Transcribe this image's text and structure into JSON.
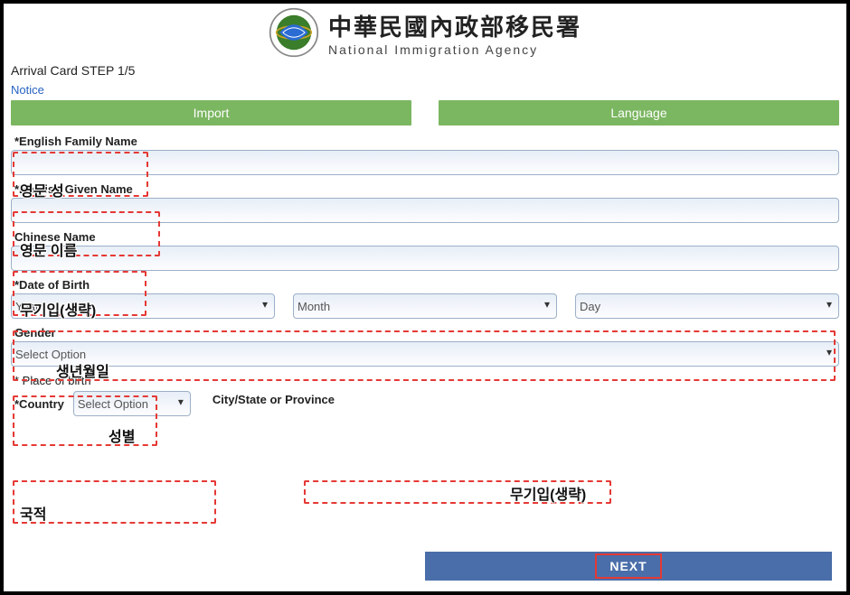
{
  "header": {
    "title_cn": "中華民國內政部移民署",
    "title_en": "National Immigration Agency"
  },
  "step": "Arrival Card STEP 1/5",
  "notice": "Notice",
  "top_buttons": {
    "import": "Import",
    "language": "Language"
  },
  "fields": {
    "family_name": {
      "label": "*English Family Name",
      "value": ""
    },
    "given_name": {
      "label": "*English Given Name",
      "value": ""
    },
    "chinese_name": {
      "label": "Chinese Name",
      "value": ""
    },
    "dob": {
      "label": "*Date of Birth",
      "year": "Year",
      "month": "Month",
      "day": "Day"
    },
    "gender": {
      "label": "Gender",
      "placeholder": "Select Option"
    },
    "place_of_birth": {
      "label": "* Place of birth",
      "country_label": "*Country",
      "country_placeholder": "Select Option",
      "city_label": "City/State or Province"
    }
  },
  "next": "NEXT",
  "annotations": {
    "family_name": "영문 성",
    "given_name": "영문 이름",
    "chinese_name": "무기입(생략)",
    "dob": "생년월일",
    "gender": "성별",
    "country": "국적",
    "city": "무기입(생략)"
  }
}
